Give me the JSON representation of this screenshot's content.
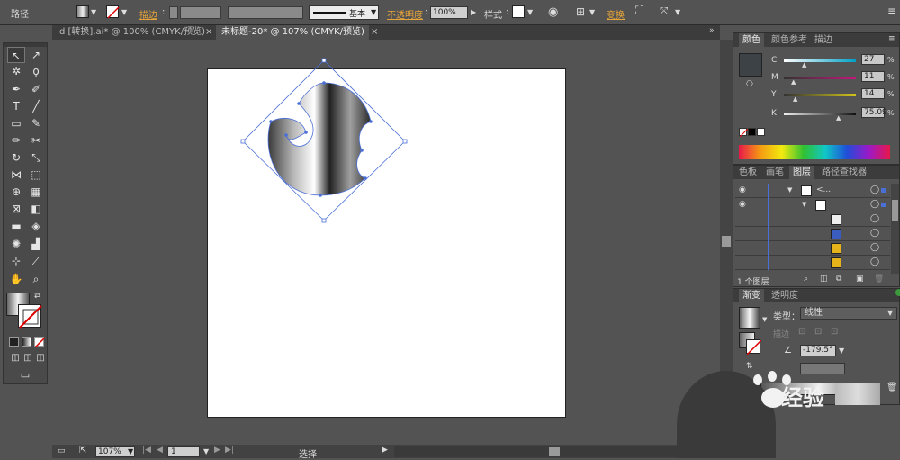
{
  "control_bar": {
    "object_type": "路径",
    "stroke_label": "描边",
    "stroke_profile": "基本",
    "opacity_label": "不透明度",
    "opacity_value": "100%",
    "style_label": "样式",
    "transform_label": "变换"
  },
  "tabs": [
    {
      "label": "d [转换].ai* @ 100% (CMYK/预览)"
    },
    {
      "label": "未标题-20* @ 107% (CMYK/预览)"
    }
  ],
  "status_bar": {
    "zoom": "107%",
    "artboard_number": "1",
    "tool_status": "选择"
  },
  "color_panel": {
    "tabs": [
      "颜色",
      "颜色参考",
      "描边"
    ],
    "channels": [
      {
        "label": "C",
        "value": "27",
        "unit": "%",
        "fraction": 0.27,
        "color": "#00a0c6"
      },
      {
        "label": "M",
        "value": "11",
        "unit": "%",
        "fraction": 0.11,
        "color": "#c2187a"
      },
      {
        "label": "Y",
        "value": "14",
        "unit": "%",
        "fraction": 0.14,
        "color": "#d0c21a"
      },
      {
        "label": "K",
        "value": "75.09",
        "unit": "%",
        "fraction": 0.75,
        "color": "#111111"
      }
    ]
  },
  "layers_panel": {
    "tabs": [
      "色板",
      "画笔",
      "图层",
      "路径查找器"
    ],
    "top_layer_name": "<...",
    "count_label": "1 个图层"
  },
  "gradient_panel": {
    "tabs": [
      "渐变",
      "透明度"
    ],
    "type_label": "类型：",
    "type_value": "线性",
    "stroke_label": "描边",
    "angle_value": "-179.5°"
  },
  "watermark": {
    "text": "经验"
  },
  "colors": {
    "bg": "#535353",
    "accent_orange": "#e8a53a",
    "selection_blue": "#4a6fd6"
  }
}
